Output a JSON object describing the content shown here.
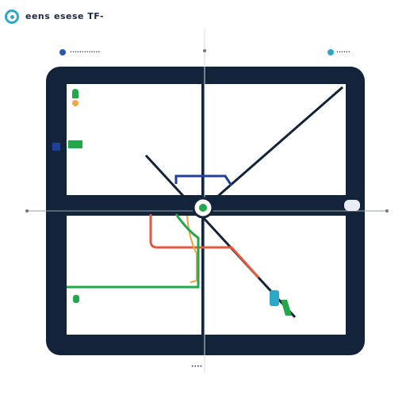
{
  "header": {
    "title": "eens",
    "subtitle": "esese TF-",
    "logo_icon": "ring-logo-icon"
  },
  "top_labels": {
    "left": "•••••••••••••",
    "right": "••••••"
  },
  "footer_label": "••••",
  "colors": {
    "frame": "#13243a",
    "green": "#22a84a",
    "blue": "#1f3f9e",
    "red": "#e4593c",
    "orange": "#f0a542",
    "cyan": "#2fa7c6",
    "dark": "#1b2a3f"
  }
}
